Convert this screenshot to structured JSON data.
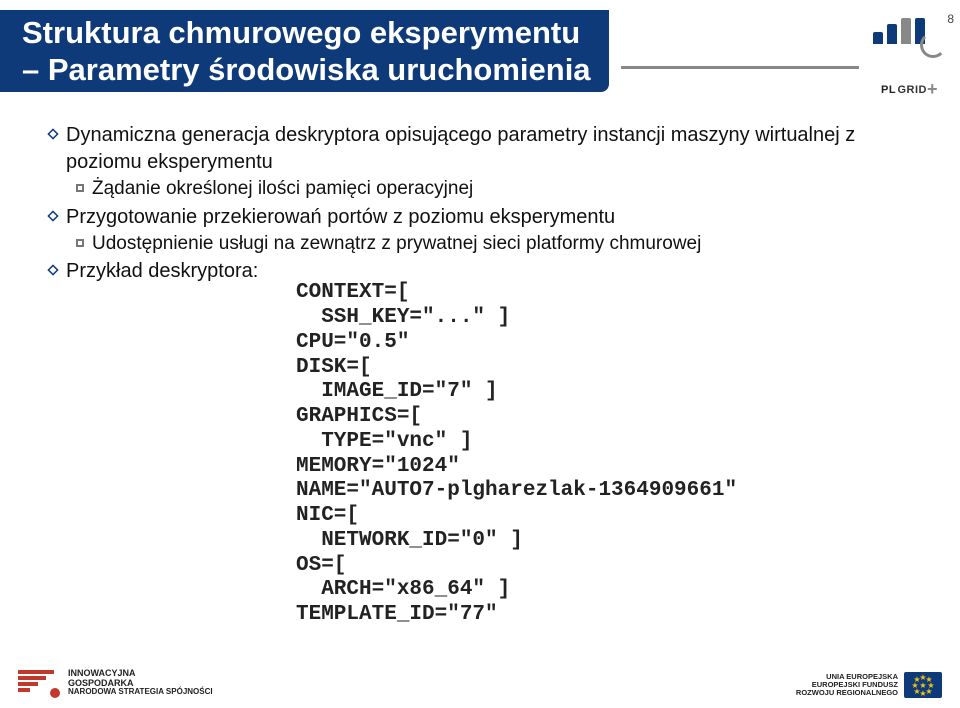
{
  "page_number": "8",
  "logo_text": {
    "main": "GRID",
    "prefix": "PL",
    "plus": "+"
  },
  "title_lines": [
    "Struktura chmurowego eksperymentu",
    "– Parametry środowiska uruchomienia"
  ],
  "bullets": [
    {
      "text": "Dynamiczna generacja deskryptora opisującego parametry instancji maszyny wirtualnej z poziomu eksperymentu",
      "sub": [
        "Żądanie określonej ilości pamięci operacyjnej"
      ]
    },
    {
      "text": "Przygotowanie przekierowań portów z poziomu eksperymentu",
      "sub": [
        "Udostępnienie usługi na zewnątrz z prywatnej sieci platformy chmurowej"
      ]
    },
    {
      "text": "Przykład deskryptora:",
      "sub": []
    }
  ],
  "code_lines": [
    "CONTEXT=[",
    "  SSH_KEY=\"...\" ]",
    "CPU=\"0.5\"",
    "DISK=[",
    "  IMAGE_ID=\"7\" ]",
    "GRAPHICS=[",
    "  TYPE=\"vnc\" ]",
    "MEMORY=\"1024\"",
    "NAME=\"AUTO7-plgharezlak-1364909661\"",
    "NIC=[",
    "  NETWORK_ID=\"0\" ]",
    "OS=[",
    "  ARCH=\"x86_64\" ]",
    "TEMPLATE_ID=\"77\""
  ],
  "footer": {
    "left": {
      "line1": "INNOWACYJNA",
      "line2": "GOSPODARKA",
      "line3": "NARODOWA STRATEGIA SPÓJNOŚCI"
    },
    "right": {
      "line1": "UNIA EUROPEJSKA",
      "line2": "EUROPEJSKI FUNDUSZ",
      "line3": "ROZWOJU REGIONALNEGO"
    }
  }
}
